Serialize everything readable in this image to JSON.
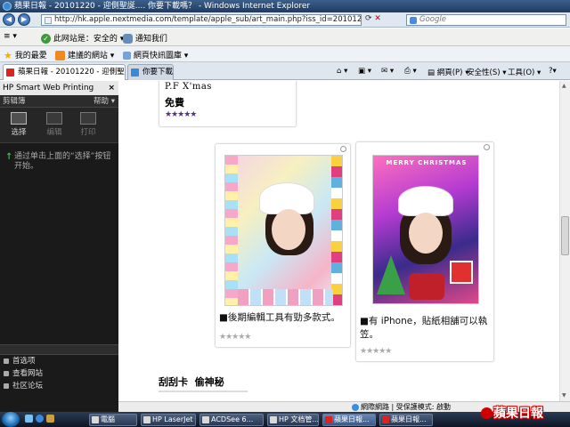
{
  "window": {
    "title": "蘋果日報 - 20101220 - 迎側聖誕.... 你要下載嗎？ - Windows Internet Explorer"
  },
  "address": {
    "url": "http://hk.apple.nextmedia.com/template/apple_sub/art_main.php?iss_id=20101220&sec_id=",
    "search_placeholder": "Google"
  },
  "toolbar1": {
    "site_status": "此网站是：安全的",
    "notify": "通知我们"
  },
  "toolbar2": {
    "favorites": "我的最愛",
    "suggested": "建議的網站",
    "web_slice": "網頁快訊圖庫"
  },
  "tabs": [
    {
      "label": "蘋果日報 - 20101220 - 迎側聖誕..."
    },
    {
      "label": "你要下載..."
    }
  ],
  "commandbar": {
    "page": "網頁(P)",
    "safety": "安全性(S)",
    "tools": "工具(O)"
  },
  "left_pane": {
    "title": "HP Smart Web Printing",
    "subheader": "剪辑簿",
    "help": "帮助",
    "tools": [
      {
        "label": "选择"
      },
      {
        "label": "编辑"
      },
      {
        "label": "打印"
      }
    ],
    "hint": "通过单击上面的“选择”按钮开始。",
    "links": [
      {
        "label": "首选项"
      },
      {
        "label": "查看网站"
      },
      {
        "label": "社区论坛"
      }
    ]
  },
  "content": {
    "top_card": {
      "title": "P.F X'mas",
      "price": "免費",
      "stars": "★★★★★"
    },
    "card_left": {
      "caption": "■後期編輯工具有勁多款式。",
      "stars": "★★★★★"
    },
    "card_right": {
      "caption": "■有 iPhone，貼紙相舖可以執笠。",
      "photo_text": "MERRY CHRISTMAS",
      "stars": "★★★★★"
    },
    "section_title": "刮刮卡  偷神秘"
  },
  "statusbar": {
    "zone": "網際網路 | 受保護模式: 啟動"
  },
  "taskbar": {
    "buttons": [
      {
        "label": "電腦"
      },
      {
        "label": "HP LaserJet"
      },
      {
        "label": "ACDSee 6..."
      },
      {
        "label": "HP 文档管..."
      },
      {
        "label": "蘋果日報..."
      },
      {
        "label": "蘋果日報..."
      }
    ]
  },
  "brand": "蘋果日報"
}
